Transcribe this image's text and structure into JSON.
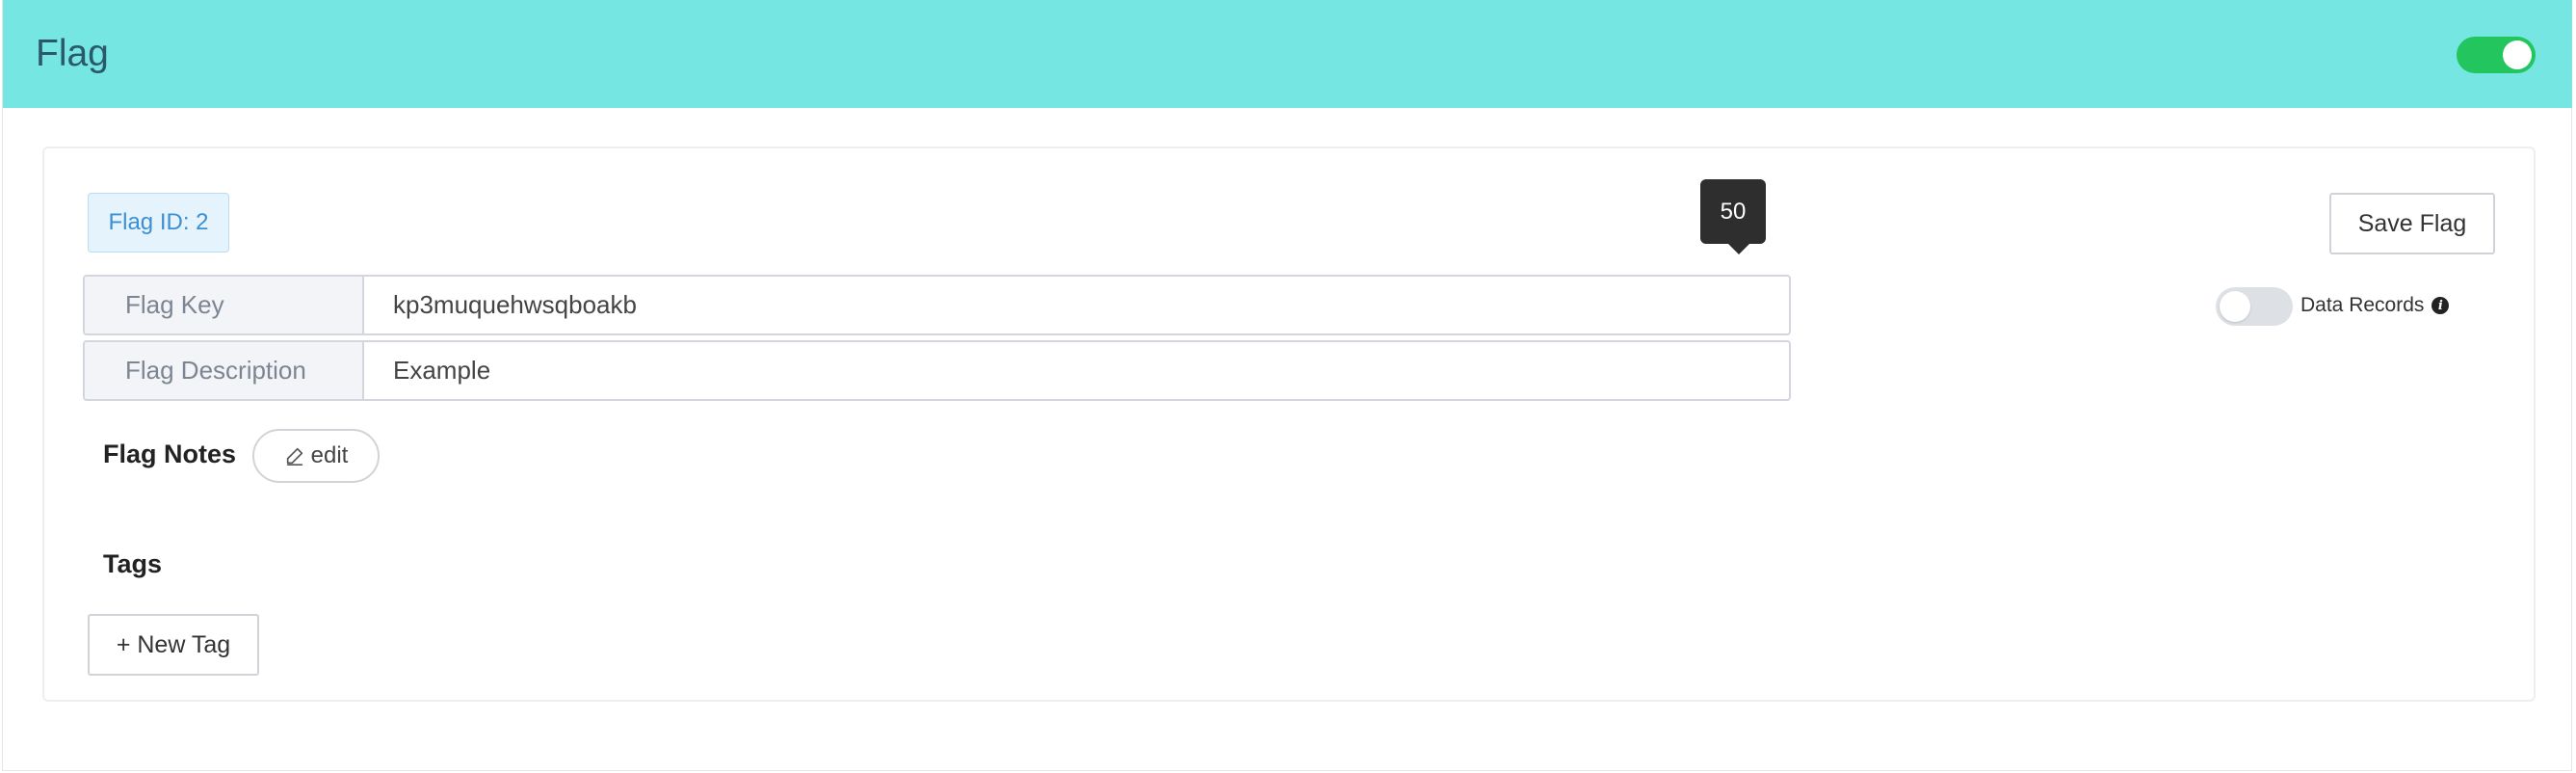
{
  "header": {
    "title": "Flag",
    "enabled_toggle": {
      "on": true,
      "color": "#22c55e"
    },
    "background": "#75e6e1"
  },
  "flag": {
    "id_badge": "Flag ID: 2",
    "tooltip_value": "50",
    "save_label": "Save Flag",
    "key_label": "Flag Key",
    "key_value": "kp3muquehwsqboakb",
    "description_label": "Flag Description",
    "description_value": "Example",
    "data_records": {
      "label": "Data Records",
      "on": false,
      "info_icon": "info-icon"
    },
    "notes": {
      "title": "Flag Notes",
      "edit_label": "edit",
      "edit_icon": "pencil-icon"
    },
    "tags": {
      "title": "Tags",
      "new_tag_label": "+ New Tag"
    }
  }
}
